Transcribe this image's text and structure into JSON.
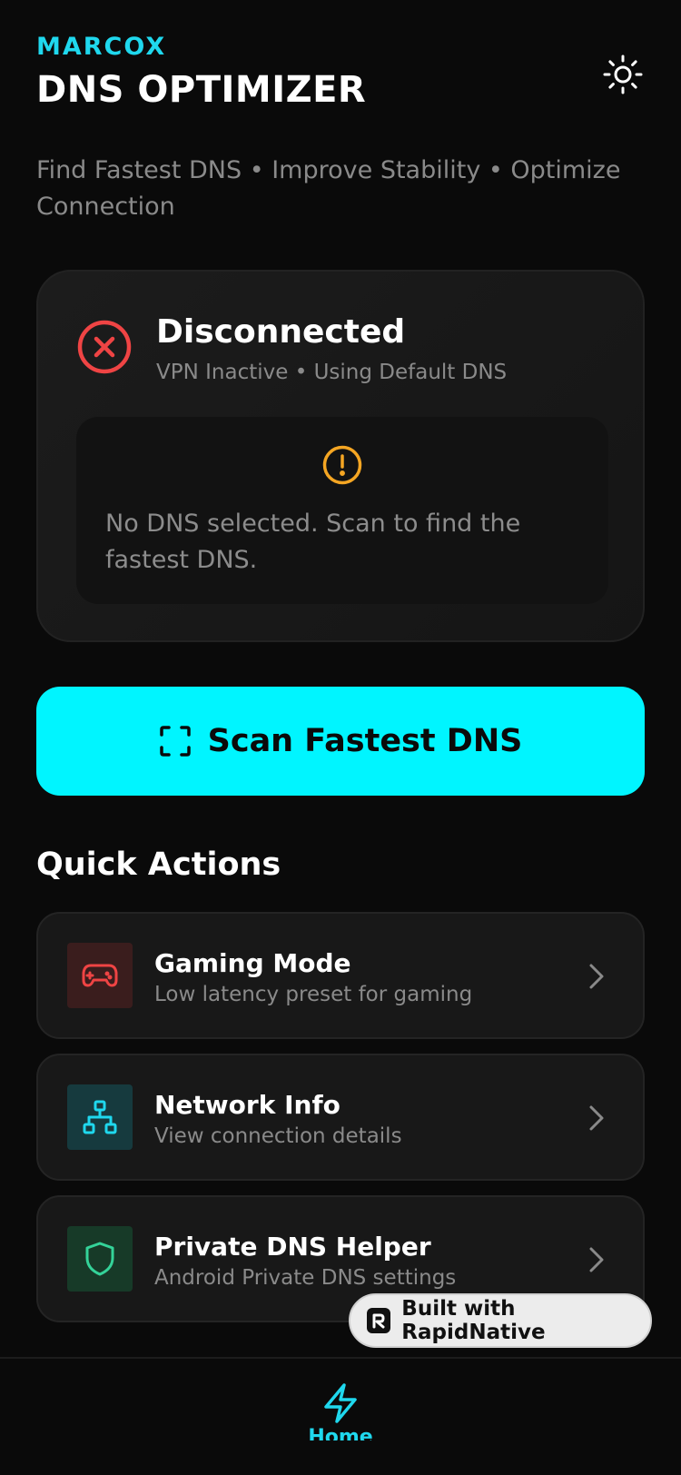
{
  "header": {
    "brand": "MARCOX",
    "title": "DNS OPTIMIZER",
    "theme_icon": "sun-icon",
    "subtitle": "Find Fastest DNS • Improve Stability • Optimize Connection"
  },
  "status": {
    "title": "Disconnected",
    "subtitle": "VPN Inactive • Using Default DNS",
    "icon": "x-circle-icon",
    "icon_color": "#ef4444",
    "notice_icon": "alert-circle-icon",
    "notice_icon_color": "#f5a623",
    "notice": "No DNS selected. Scan to find the fastest DNS."
  },
  "scan_button": {
    "label": "Scan Fastest DNS",
    "icon": "scan-icon",
    "color": "#00f5ff"
  },
  "quick_actions": {
    "title": "Quick Actions",
    "items": [
      {
        "title": "Gaming Mode",
        "subtitle": "Low latency preset for gaming",
        "icon": "gamepad-icon",
        "color": "#ef4444",
        "bg": "#3a1d1d"
      },
      {
        "title": "Network Info",
        "subtitle": "View connection details",
        "icon": "network-icon",
        "color": "#1fd8ee",
        "bg": "#163a3e"
      },
      {
        "title": "Private DNS Helper",
        "subtitle": "Android Private DNS settings",
        "icon": "shield-icon",
        "color": "#34d399",
        "bg": "#173a28"
      }
    ]
  },
  "badge": {
    "label": "Built with RapidNative"
  },
  "bottom_nav": {
    "home_label": "Home",
    "home_icon": "lightning-icon",
    "accent": "#1fd8ee"
  }
}
